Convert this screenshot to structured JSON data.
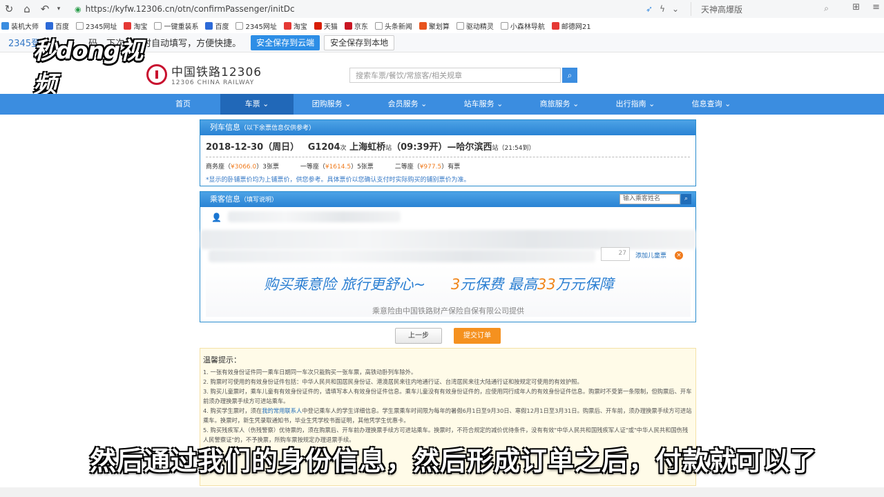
{
  "browser": {
    "url": "https://kyfw.12306.cn/otn/confirmPassenger/initDc",
    "search_engine_text": "天神高爆版",
    "bookmarks": [
      "装机大师",
      "百度",
      "2345网址",
      "淘宝",
      "一键重装系",
      "百度",
      "2345网址",
      "淘宝",
      "天猫",
      "京东",
      "头条新闻",
      "聚划算",
      "驱动精灵",
      "小森林导航",
      "邮德网21"
    ]
  },
  "infobar": {
    "prefix": "2345登",
    "message": "码，下次访问时自动填写，方便快捷。",
    "cloud_button": "安全保存到云端",
    "local_button": "安全保存到本地"
  },
  "watermark": {
    "text": "秒dong视频"
  },
  "site": {
    "logo_cn": "中国铁路12306",
    "logo_en": "12306 CHINA RAILWAY",
    "search_placeholder": "搜索车票/餐饮/常旅客/相关规章"
  },
  "nav": {
    "items": [
      "首页",
      "车票 ⌄",
      "团购服务 ⌄",
      "会员服务 ⌄",
      "站车服务 ⌄",
      "商旅服务 ⌄",
      "出行指南 ⌄",
      "信息查询 ⌄"
    ],
    "active_index": 1
  },
  "train_info": {
    "header": "列车信息",
    "header_note": "（以下余票信息仅供参考）",
    "date": "2018-12-30（周日）",
    "train_no": "G1204",
    "train_suffix": "次",
    "from": "上海虹桥",
    "station_suffix": "站",
    "depart": "（09:39开）",
    "to": "哈尔滨西",
    "arrive": "（21:54到）",
    "seats": [
      {
        "name": "商务座（",
        "price": "¥3066.0",
        "count": "）3张票"
      },
      {
        "name": "一等座（",
        "price": "¥1614.5",
        "count": "）5张票"
      },
      {
        "name": "二等座（",
        "price": "¥977.5",
        "count": "）有票"
      }
    ],
    "note": "*显示的卧铺票价均为上铺票价，供您参考。具体票价以您确认支付时实际购买的铺别票价为准。"
  },
  "passenger": {
    "header": "乘客信息",
    "header_note": "（填写说明）",
    "search_placeholder": "输入乘客姓名",
    "ticket_suffix": "27",
    "add_child": "添加儿童票"
  },
  "insurance": {
    "main_1": "购买乘意险  旅行更舒心~",
    "num_1": "3",
    "main_2": "元保费  最高",
    "num_2": "33",
    "main_3": "万元保障",
    "sub": "乘意险由中国铁路财产保险自保有限公司提供"
  },
  "buttons": {
    "prev": "上一步",
    "submit": "提交订单"
  },
  "tips": {
    "title": "温馨提示：",
    "lines": [
      "1. 一张有效身份证件同一乘车日期同一车次只能购买一张车票，高铁动卧列车除外。",
      "2. 购票时可使用的有效身份证件包括：中华人民共和国居民身份证、港澳居民来往内地通行证、台湾居民来往大陆通行证和按规定可使用的有效护照。",
      "3. 购买儿童票时，乘车儿童有有效身份证件的，请填写本人有效身份证件信息。乘车儿童没有有效身份证件的，应使用同行成年人的有效身份证件信息。购票时不受第一条限制，但购票后、开车前须办理换票手续方可进站乘车。",
      "4. 购买学生票时，须在",
      "我的常用联系人",
      "中登记乘车人的学生详细信息。学生票乘车时间限为每年的暑假6月1日至9月30日、寒假12月1日至3月31日。购票后、开车前，须办理换票手续方可进站乘车。换票时，新生凭录取通知书，毕业生凭学校书面证明，其他凭学生优惠卡。",
      "5. 购买残疾军人（伤残警察）优待票的，须在购票后、开车前办理换票手续方可进站乘车。换票时，不符合规定的减价优待条件，没有有效\"中华人民共和国残疾军人证\"或\"中华人民共和国伤残人民警察证\"的，不予换票，所购车票按规定办理退票手续。"
    ]
  },
  "subtitle": "然后通过我们的身份信息，然后形成订单之后，付款就可以了"
}
